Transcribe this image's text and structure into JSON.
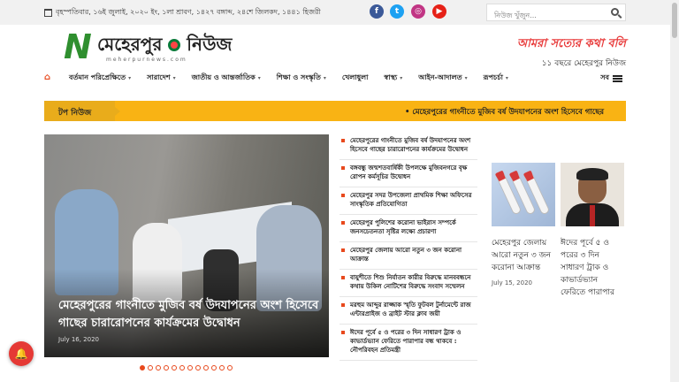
{
  "topbar": {
    "date": "বৃহস্পতিবার, ১৬ই জুলাই, ২০২০ ইং, ১লা শ্রাবণ, ১৪২৭ বঙ্গাব্দ, ২৪শে জিলকদ, ১৪৪১ হিজরী",
    "social": [
      {
        "icon": "facebook-icon",
        "glyph": "f",
        "color": "#3b5998"
      },
      {
        "icon": "twitter-icon",
        "glyph": "t",
        "color": "#1da1f2"
      },
      {
        "icon": "instagram-icon",
        "glyph": "◎",
        "color": "#c13584"
      },
      {
        "icon": "youtube-icon",
        "glyph": "▶",
        "color": "#e62117"
      }
    ],
    "search_placeholder": "নিউজ খুঁজুন...",
    "search_icon": "search-icon"
  },
  "logo": {
    "letter": "N",
    "title": "মেহেরপুর",
    "title2": "নিউজ",
    "sub": "meherpurnews.com"
  },
  "tagline": {
    "line1": "আমরা সত্যের কথা বলি",
    "line2": "১১ বছরে মেহেরপুর নিউজ"
  },
  "nav": {
    "items": [
      "বর্তমান পরিপ্রেক্ষিতে",
      "সারাদেশ",
      "জাতীয় ও আন্তর্জাতিক",
      "শিক্ষা ও সংস্কৃতি",
      "খেলাধুলা",
      "স্বাস্থ্য",
      "আইন-আদালত",
      "রূপচর্চা"
    ],
    "all_label": "সব"
  },
  "ticker": {
    "label": "টপ নিউজ",
    "text": "• মেহেরপুরের গাংনীতে মুজিব বর্ষ উদযাপনের অংশ হিসেবে গাছের"
  },
  "hero": {
    "caption": "মেহেরপুরের গাংনীতে মুজিব বর্ষ উদযাপনের অংশ হিসেবে গাছের চারারোপনের কার্যক্রমের উদ্বোধন",
    "date": "July 16, 2020"
  },
  "headlines": [
    "মেহেরপুরের গাংনীতে মুজিব বর্ষ উদযাপনের অংশ হিসেবে গাছের চারারোপনের কার্যক্রমের উদ্বোধন",
    "বঙ্গবন্ধু জন্মশতবার্ষিকী উপলক্ষে মুজিবনগরে বৃক্ষ রোপন কর্মসূচির উদ্বোধন",
    "মেহেরপুর সদর উপজেলা প্রাথমিক শিক্ষা অফিসের সাংস্কৃতিক প্রতিযোগিতা",
    "মেহেরপুর পুলিশের করোনা ভাইরাস সম্পর্কে জনসচেতনতা সৃষ্টির লক্ষ্যে প্রচারণা",
    "মেহেরপুর জেলায় আরো নতুন ৩ জন করোনা আক্রান্ত",
    "বাযুশীতে শিশু নির্যাতন কারীর বিরুদ্ধে মানববন্ধনে কথায় উকিল নোটিশের বিরুদ্ধে সংবাদ সম্মেলন",
    "মরহুম আব্দুর রাজ্জাক স্মৃতি ফুটবল টুর্নামেন্টে রাজ এন্টারপ্রাইজ ও ব্রাইট স্টার ক্লাব জয়ী",
    "ঈদের পূর্বে ৫ ও পরের ৩ দিন সাধারণ ট্রাক ও কাভার্ডভ্যান ফেরিতে পারাপার বন্ধ থাকবে : নৌপরিবহন প্রতিমন্ত্রী"
  ],
  "cards": [
    {
      "title": "মেহেরপুর জেলায় আরো নতুন ৩ জন করোনা আক্রান্ত",
      "date": "July 15, 2020"
    },
    {
      "title": "ঈদের পূর্বে ৫ ও পরের ৩ দিন সাধারণ ট্রাক ও কাভার্ডভ্যান ফেরিতে পারাপার",
      "date": ""
    }
  ],
  "slider": {
    "count": 12,
    "active": 0
  }
}
